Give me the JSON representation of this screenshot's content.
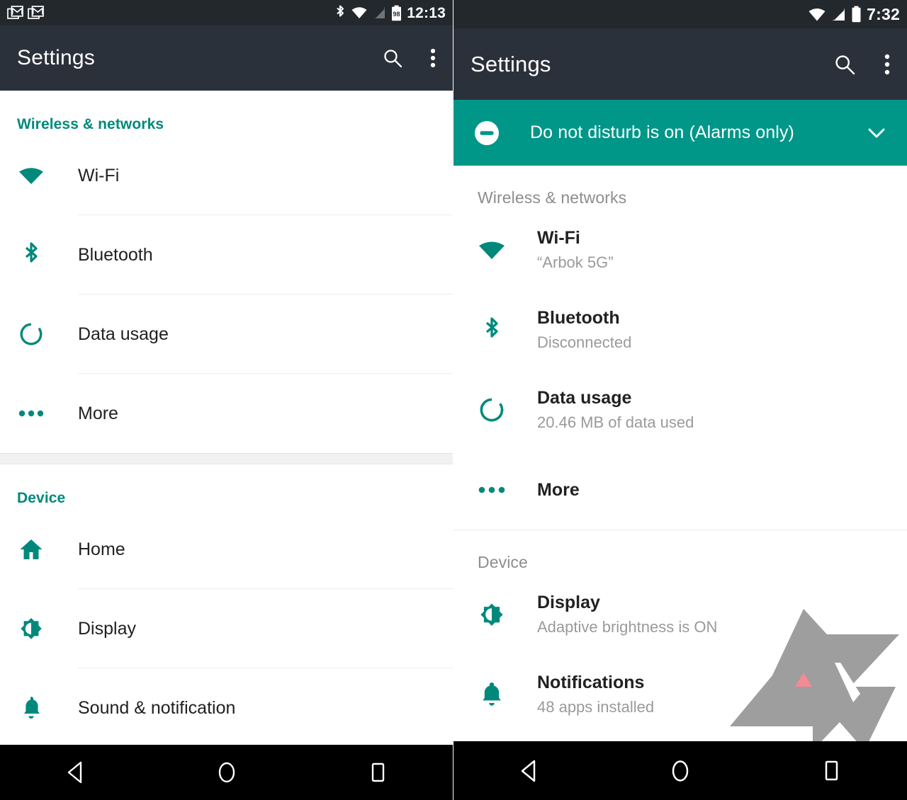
{
  "left_phone": {
    "status_bar": {
      "notification_icons": [
        "gmail-icon",
        "gmail-icon"
      ],
      "system_icons": [
        "bluetooth-icon",
        "wifi-icon",
        "cell-signal-icon",
        "battery-icon"
      ],
      "battery_level": "98",
      "time": "12:13"
    },
    "app_bar": {
      "title": "Settings",
      "search_icon": "search-icon",
      "overflow_icon": "more-vert-icon"
    },
    "sections": [
      {
        "header": "Wireless & networks",
        "items": [
          {
            "icon": "wifi-icon",
            "title": "Wi-Fi",
            "subtitle": ""
          },
          {
            "icon": "bluetooth-icon",
            "title": "Bluetooth",
            "subtitle": ""
          },
          {
            "icon": "data-usage-icon",
            "title": "Data usage",
            "subtitle": ""
          },
          {
            "icon": "more-horiz-icon",
            "title": "More",
            "subtitle": ""
          }
        ]
      },
      {
        "header": "Device",
        "items": [
          {
            "icon": "home-icon",
            "title": "Home",
            "subtitle": ""
          },
          {
            "icon": "brightness-icon",
            "title": "Display",
            "subtitle": ""
          },
          {
            "icon": "bell-icon",
            "title": "Sound & notification",
            "subtitle": ""
          }
        ]
      }
    ],
    "nav_bar": {
      "back": "back-triangle-icon",
      "home": "home-circle-icon",
      "recents": "recents-square-icon"
    }
  },
  "right_phone": {
    "status_bar": {
      "notification_icons": [],
      "system_icons": [
        "wifi-icon",
        "cell-signal-icon",
        "battery-icon"
      ],
      "time": "7:32"
    },
    "app_bar": {
      "title": "Settings",
      "search_icon": "search-icon",
      "overflow_icon": "more-vert-icon"
    },
    "dnd_banner": {
      "icon": "do-not-disturb-icon",
      "text": "Do not disturb is on (Alarms only)",
      "expand_icon": "chevron-down-icon"
    },
    "sections": [
      {
        "header": "Wireless & networks",
        "items": [
          {
            "icon": "wifi-icon",
            "title": "Wi-Fi",
            "subtitle": "“Arbok 5G”"
          },
          {
            "icon": "bluetooth-icon",
            "title": "Bluetooth",
            "subtitle": "Disconnected"
          },
          {
            "icon": "data-usage-icon",
            "title": "Data usage",
            "subtitle": "20.46 MB of data used"
          },
          {
            "icon": "more-horiz-icon",
            "title": "More",
            "subtitle": ""
          }
        ]
      },
      {
        "header": "Device",
        "items": [
          {
            "icon": "brightness-icon",
            "title": "Display",
            "subtitle": "Adaptive brightness is ON"
          },
          {
            "icon": "bell-icon",
            "title": "Notifications",
            "subtitle": "48 apps installed"
          }
        ]
      }
    ],
    "watermark": "android-police-logo",
    "nav_bar": {
      "back": "back-triangle-icon",
      "home": "home-circle-icon",
      "recents": "recents-square-icon"
    }
  },
  "colors": {
    "accent_teal": "#009688",
    "accent_teal_dark": "#00897b",
    "app_bar": "#2b313a",
    "status_bar": "#23282d",
    "nav_bar": "#000000",
    "primary_text": "#212121",
    "secondary_text": "#9a9a9a",
    "section_header_right": "#8d8d8d",
    "divider": "#eceded",
    "watermark_gray": "#9e9e9e",
    "watermark_pink": "#f48a95"
  }
}
